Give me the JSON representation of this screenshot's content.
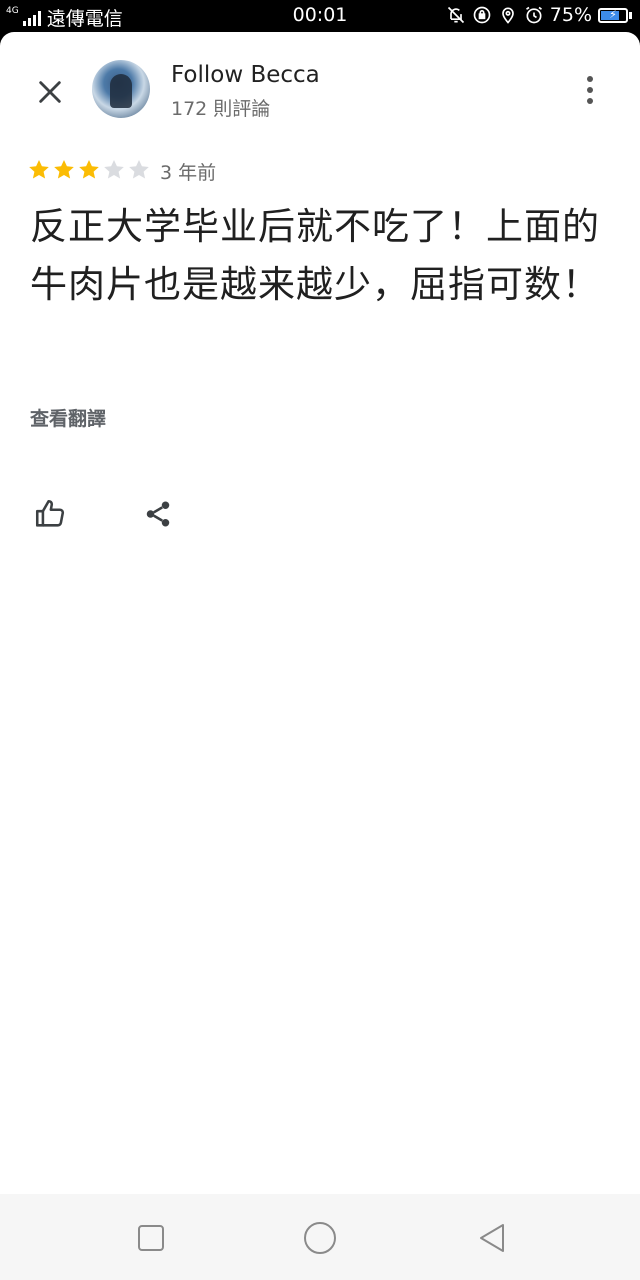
{
  "status_bar": {
    "network": "4G",
    "carrier": "遠傳電信",
    "time": "00:01",
    "battery": "75%",
    "battery_level": 0.75,
    "battery_color": "#3d8be8"
  },
  "reviewer": {
    "name": "Follow Becca",
    "review_count": "172 則評論"
  },
  "review": {
    "rating": 3,
    "max_rating": 5,
    "time_ago": "3 年前",
    "text": "反正大学毕业后就不吃了！上面的牛肉片也是越来越少，屈指可数！",
    "translate_label": "查看翻譯"
  },
  "colors": {
    "star_filled": "#fbbc04",
    "star_empty": "#dadce0",
    "icon": "#3c4043"
  },
  "icons": {
    "close": "close-icon",
    "more": "more-vert-icon",
    "like": "thumb-up-icon",
    "share": "share-icon",
    "nav_recents": "square-icon",
    "nav_home": "circle-icon",
    "nav_back": "triangle-back-icon"
  }
}
